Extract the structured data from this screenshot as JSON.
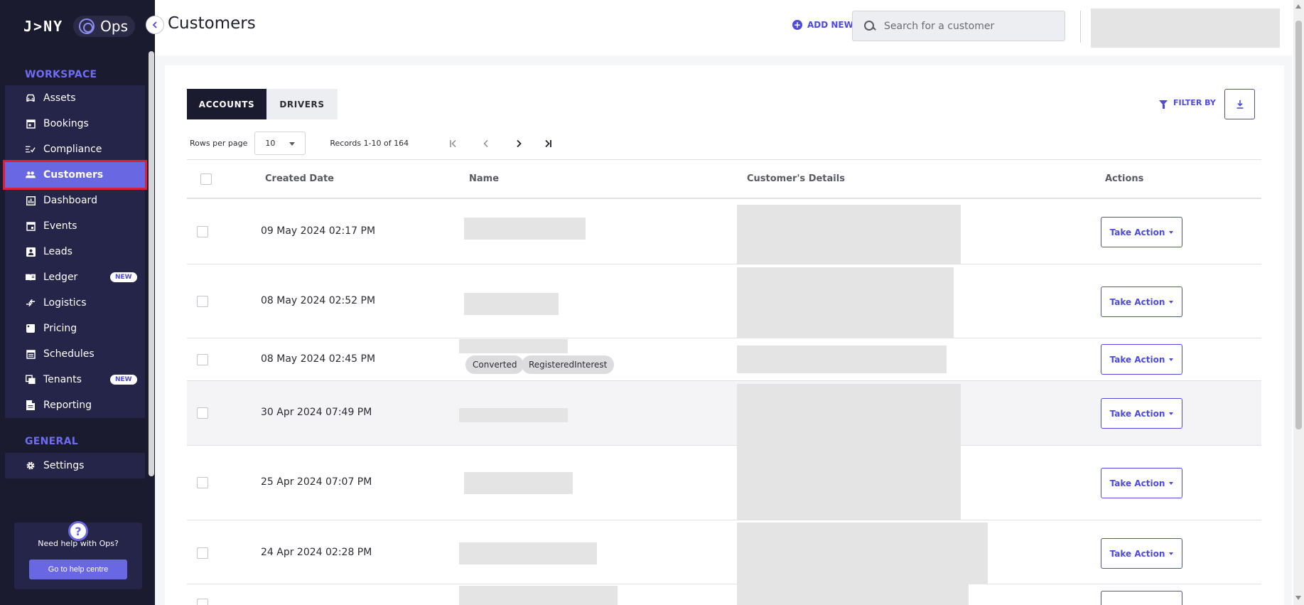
{
  "sidebar": {
    "logo_text": "J>NY",
    "product": "Ops",
    "workspace_label": "WORKSPACE",
    "general_label": "GENERAL",
    "workspace_items": [
      {
        "label": "Assets",
        "icon": "car-icon"
      },
      {
        "label": "Bookings",
        "icon": "calendar-icon"
      },
      {
        "label": "Compliance",
        "icon": "checklist-icon"
      },
      {
        "label": "Customers",
        "icon": "people-icon",
        "active": true
      },
      {
        "label": "Dashboard",
        "icon": "bar-chart-icon"
      },
      {
        "label": "Events",
        "icon": "event-icon"
      },
      {
        "label": "Leads",
        "icon": "contact-card-icon"
      },
      {
        "label": "Ledger",
        "icon": "book-icon",
        "badge": "NEW"
      },
      {
        "label": "Logistics",
        "icon": "transfer-icon"
      },
      {
        "label": "Pricing",
        "icon": "price-tag-icon"
      },
      {
        "label": "Schedules",
        "icon": "schedule-icon"
      },
      {
        "label": "Tenants",
        "icon": "tenants-icon",
        "badge": "NEW"
      },
      {
        "label": "Reporting",
        "icon": "report-icon"
      }
    ],
    "general_items": [
      {
        "label": "Settings",
        "icon": "gear-icon"
      }
    ],
    "help": {
      "text": "Need help with Ops?",
      "button": "Go to help centre"
    }
  },
  "header": {
    "title": "Customers",
    "add_new": "ADD NEW",
    "search_placeholder": "Search for a customer"
  },
  "tabs": [
    {
      "label": "ACCOUNTS",
      "active": true
    },
    {
      "label": "DRIVERS",
      "active": false
    }
  ],
  "toolbar": {
    "filter_label": "FILTER BY",
    "rows_per_page_label": "Rows per page",
    "rows_per_page_value": "10",
    "records_text": "Records 1-10 of 164"
  },
  "table": {
    "columns": [
      "Created Date",
      "Name",
      "Customer's Details",
      "Actions"
    ],
    "action_label": "Take Action",
    "rows": [
      {
        "created": "09 May 2024 02:17 PM",
        "tags": []
      },
      {
        "created": "08 May 2024 02:52 PM",
        "tags": []
      },
      {
        "created": "08 May 2024 02:45 PM",
        "tags": [
          "Converted",
          "RegisteredInterest"
        ]
      },
      {
        "created": "30 Apr 2024 07:49 PM",
        "tags": []
      },
      {
        "created": "25 Apr 2024 07:07 PM",
        "tags": []
      },
      {
        "created": "24 Apr 2024 02:28 PM",
        "tags": []
      }
    ]
  },
  "colors": {
    "sidebar_bg": "#1b1b2f",
    "accent": "#4c4ae0",
    "active_item": "#6a67e3",
    "highlight_outline": "#e01e37"
  }
}
